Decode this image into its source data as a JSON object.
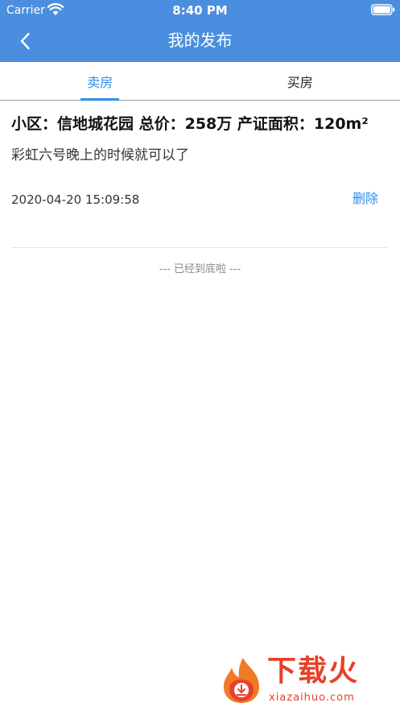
{
  "status_bar": {
    "carrier": "Carrier",
    "time": "8:40 PM"
  },
  "nav": {
    "title": "我的发布"
  },
  "tabs": [
    {
      "label": "卖房",
      "active": true
    },
    {
      "label": "买房",
      "active": false
    }
  ],
  "listing": {
    "title": "小区：信地城花园 总价：258万 产证面积：120m²",
    "description": "彩虹六号晚上的时候就可以了",
    "timestamp": "2020-04-20 15:09:58",
    "delete_label": "删除"
  },
  "end_note": "--- 已经到底啦 ---",
  "watermark": {
    "text": "下载火",
    "domain": "xiazaihuo.com"
  },
  "colors": {
    "header": "#4a8fdf",
    "accent": "#2d8ef0",
    "watermark": "#e8402a"
  }
}
